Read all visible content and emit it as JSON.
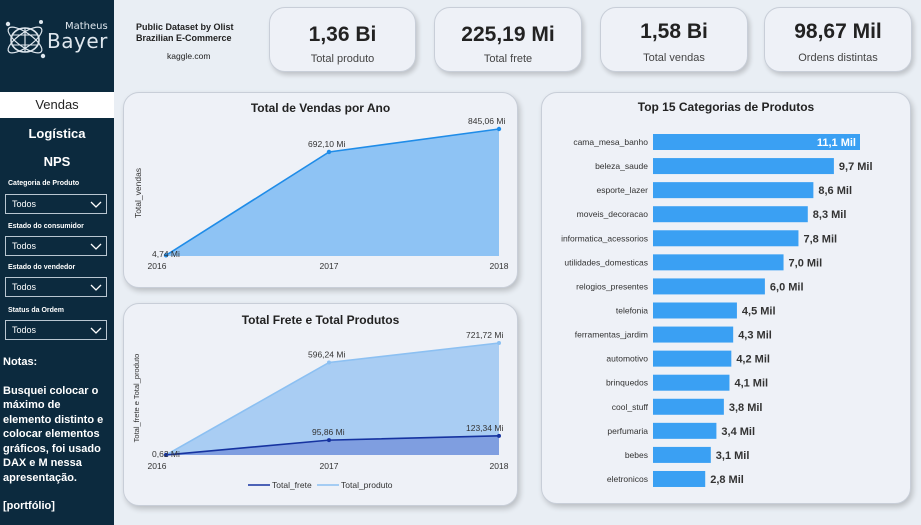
{
  "sidebar": {
    "logo_small": "Matheus",
    "logo_big": "Bayer",
    "nav": [
      "Vendas",
      "Logística",
      "NPS"
    ],
    "filters": [
      {
        "label": "Categoria de Produto",
        "value": "Todos"
      },
      {
        "label": "Estado do consumidor",
        "value": "Todos"
      },
      {
        "label": "Estado do vendedor",
        "value": "Todos"
      },
      {
        "label": "Status da Ordem",
        "value": "Todos"
      }
    ],
    "notes_title": "Notas:",
    "notes_text": "Busquei colocar o máximo de elemento distinto e colocar elementos gráficos, foi usado DAX e M nessa apresentação.",
    "notes_link": "[portfólio]"
  },
  "header": {
    "dataset_line1": "Public Dataset by Olist",
    "dataset_line2": "Brazilian E-Commerce",
    "dataset_source": "kaggle.com"
  },
  "kpis": [
    {
      "value": "1,36 Bi",
      "label": "Total produto"
    },
    {
      "value": "225,19 Mi",
      "label": "Total frete"
    },
    {
      "value": "1,58 Bi",
      "label": "Total vendas"
    },
    {
      "value": "98,67 Mil",
      "label": "Ordens distintas"
    }
  ],
  "colors": {
    "sidebar": "#0c2a3e",
    "bar": "#3aa0f3",
    "area_vendas": "#8ec3f4",
    "line_vendas": "#1f8ce8",
    "area_produto": "#a9cdf3",
    "line_produto": "#8cc0f2",
    "line_frete": "#1633a0",
    "area_frete": "#7f9ee0"
  },
  "chart_data": [
    {
      "type": "area",
      "title": "Total de Vendas por Ano",
      "ylabel": "Total_vendas",
      "xlabel": "",
      "x": [
        "2016",
        "2017",
        "2018"
      ],
      "values": [
        4.74,
        692.1,
        845.06
      ],
      "data_labels": [
        "4,74 Mi",
        "692,10 Mi",
        "845,06 Mi"
      ],
      "ylim": [
        0,
        845.06
      ]
    },
    {
      "type": "area",
      "title": "Total Frete e Total Produtos",
      "ylabel": "Total_frete e Total_produto",
      "xlabel": "",
      "x": [
        "2016",
        "2017",
        "2018"
      ],
      "series": [
        {
          "name": "Total_frete",
          "values": [
            0.62,
            95.86,
            123.34
          ],
          "data_labels": [
            "0,62 Mi",
            "95,86 Mi",
            "123,34 Mi"
          ]
        },
        {
          "name": "Total_produto",
          "values": [
            0.62,
            596.24,
            721.72
          ],
          "data_labels": [
            "",
            "596,24 Mi",
            "721,72 Mi"
          ]
        }
      ],
      "legend": "bottom",
      "ylim": [
        0,
        721.72
      ]
    },
    {
      "type": "bar",
      "orientation": "horizontal",
      "title": "Top 15 Categorias de Produtos",
      "categories": [
        "cama_mesa_banho",
        "beleza_saude",
        "esporte_lazer",
        "moveis_decoracao",
        "informatica_acessorios",
        "utilidades_domesticas",
        "relogios_presentes",
        "telefonia",
        "ferramentas_jardim",
        "automotivo",
        "brinquedos",
        "cool_stuff",
        "perfumaria",
        "bebes",
        "eletronicos"
      ],
      "values": [
        11.1,
        9.7,
        8.6,
        8.3,
        7.8,
        7.0,
        6.0,
        4.5,
        4.3,
        4.2,
        4.1,
        3.8,
        3.4,
        3.1,
        2.8
      ],
      "data_labels": [
        "11,1 Mil",
        "9,7 Mil",
        "8,6 Mil",
        "8,3 Mil",
        "7,8 Mil",
        "7,0 Mil",
        "6,0 Mil",
        "4,5 Mil",
        "4,3 Mil",
        "4,2 Mil",
        "4,1 Mil",
        "3,8 Mil",
        "3,4 Mil",
        "3,1 Mil",
        "2,8 Mil"
      ]
    }
  ]
}
